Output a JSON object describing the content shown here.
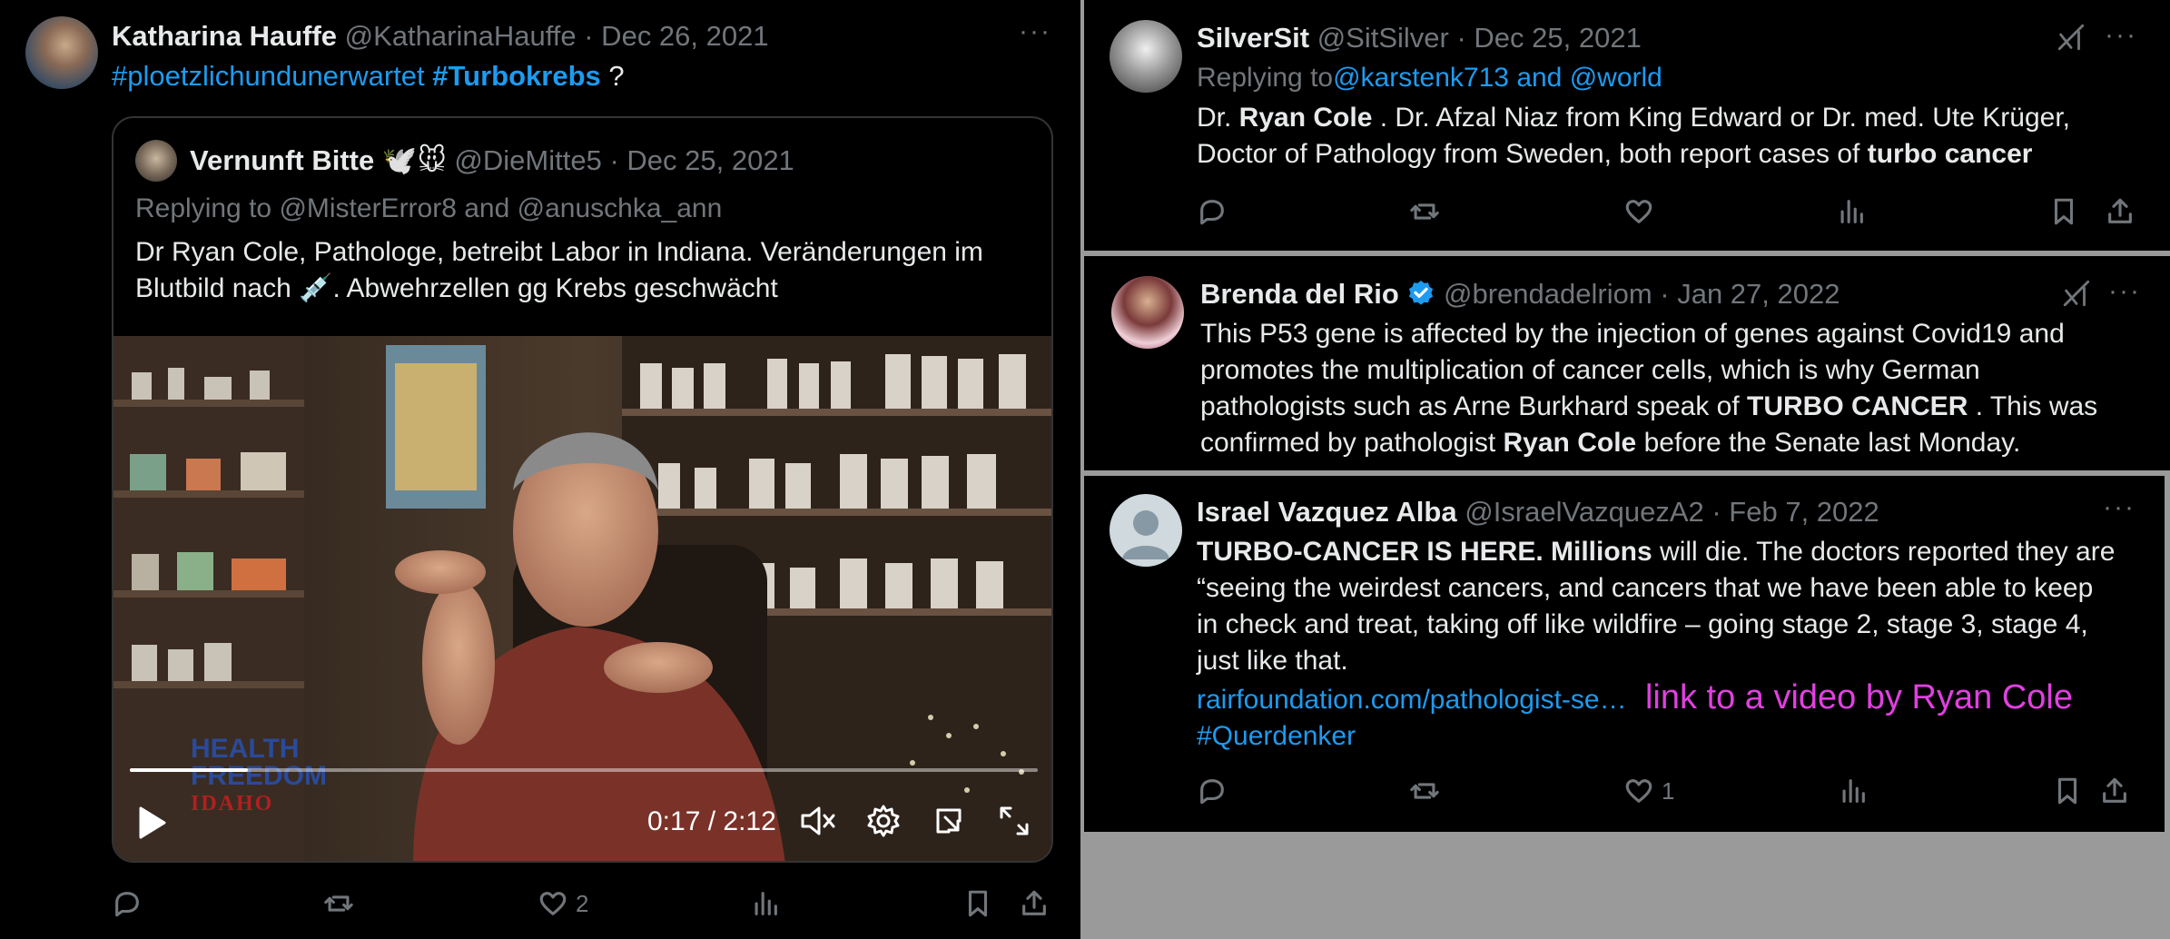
{
  "left_tweet": {
    "name": "Katharina Hauffe",
    "handle": "@KatharinaHauffe",
    "date": "· Dec 26, 2021",
    "hashtag1": "#ploetzlichundunerwartet",
    "hashtag2": "#Turbokrebs",
    "question": "?",
    "more": "···",
    "quote": {
      "name": "Vernunft Bitte",
      "emoji": "🕊️🐭",
      "handle": "@DieMitte5",
      "date": "· Dec 25, 2021",
      "replying_prefix": "Replying to",
      "replying_user1": "@MisterError8",
      "replying_and": "and",
      "replying_user2": "@anuschka_ann",
      "line1": "Dr Ryan Cole, Pathologe, betreibt  Labor in Indiana. Veränderungen im",
      "line2a": "Blutbild nach",
      "syringe": "💉",
      "line2b": ". Abwehrzellen gg Krebs geschwächt",
      "video": {
        "time": "0:17 / 2:12",
        "watermark1": "HEALTH",
        "watermark2": "FREEDOM",
        "watermark3": "IDAHO",
        "progress_fraction": 0.13
      }
    },
    "actions": {
      "likes": "2"
    }
  },
  "right_tweets": [
    {
      "name": "SilverSit",
      "handle": "@SitSilver",
      "date": "· Dec 25, 2021",
      "replying_prefix": "Replying to",
      "replying_users": "@karstenk713 and @world",
      "line1_a": "Dr. ",
      "line1_b": "Ryan Cole",
      "line1_c": " . Dr. Afzal Niaz from King Edward or Dr. med. Ute Krüger,",
      "line2_a": "Doctor of Pathology from Sweden, both report cases of ",
      "line2_b": "turbo cancer",
      "more": "···"
    },
    {
      "name": "Brenda del Rio",
      "handle": "@brendadelriom",
      "date": "· Jan 27, 2022",
      "line1": "This P53 gene is affected by the injection of genes against Covid19 and",
      "line2": "promotes the multiplication of cancer cells, which is why German",
      "line3_a": "pathologists such as Arne Burkhard speak of ",
      "line3_b": "TURBO CANCER",
      "line3_c": " . This was",
      "line4_a": "confirmed by pathologist ",
      "line4_b": "Ryan Cole",
      "line4_c": " before the Senate last Monday.",
      "more": "···"
    },
    {
      "name": "Israel Vazquez Alba",
      "handle": "@IsraelVazquezA2",
      "date": "· Feb 7, 2022",
      "line1_a": "TURBO-CANCER IS HERE. Millions",
      "line1_b": " will die. The doctors reported they are",
      "line2": "“seeing the weirdest cancers, and cancers that we have been able to keep",
      "line3": "in check and treat, taking off like wildfire – going stage 2, stage 3, stage 4,",
      "line4": "just like that.",
      "url": "rairfoundation.com/pathologist-se…",
      "annotation": "link to a video by Ryan Cole",
      "hashtag": "#Querdenker",
      "likes": "1",
      "more": "···"
    }
  ],
  "colors": {
    "link": "#1d9bf0",
    "annotation": "#e040e0",
    "muted": "#71767b",
    "verified": "#1d9bf0"
  }
}
